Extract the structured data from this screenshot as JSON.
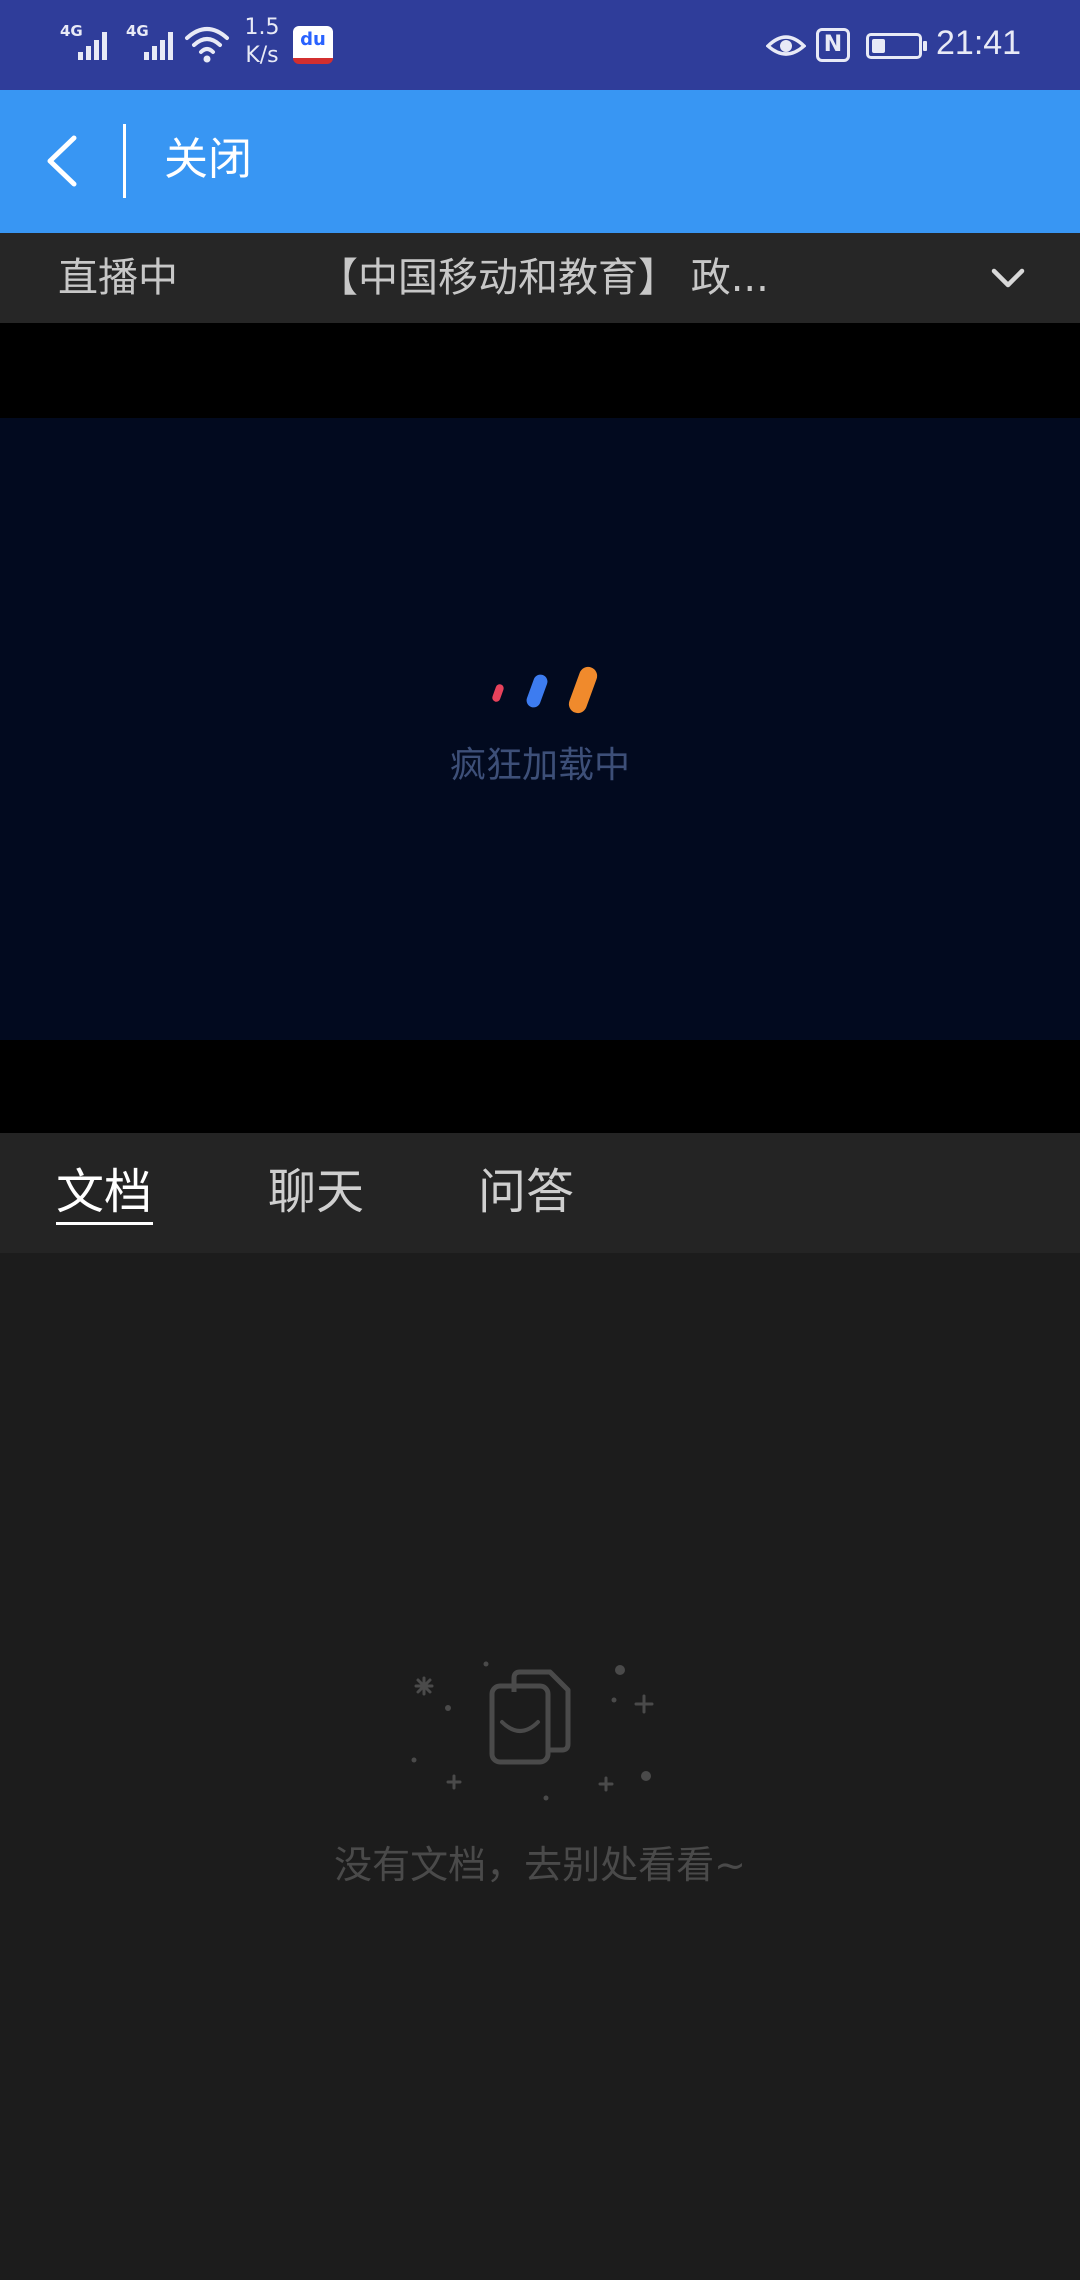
{
  "status_bar": {
    "network_1": "4G",
    "network_2": "4G",
    "speed_value": "1.5",
    "speed_unit": "K/s",
    "time": "21:41",
    "battery_level": 0.3,
    "icons": [
      "signal-icon",
      "wifi-icon",
      "baidu-app-icon",
      "eye-icon",
      "nfc-icon",
      "battery-icon"
    ]
  },
  "nav": {
    "close_label": "关闭"
  },
  "live_bar": {
    "status": "直播中",
    "title": "【中国移动和教育】 政..."
  },
  "player": {
    "loading_text": "疯狂加载中",
    "loader_colors": [
      "#e8425b",
      "#3d7cf0",
      "#f08a2c"
    ]
  },
  "tabs": [
    {
      "label": "文档",
      "active": true
    },
    {
      "label": "聊天",
      "active": false
    },
    {
      "label": "问答",
      "active": false
    }
  ],
  "empty_state": {
    "message": "没有文档，去别处看看~"
  },
  "colors": {
    "status_bar": "#2f3d9a",
    "nav_bar": "#3896f3",
    "live_bar": "#262626",
    "video_bg": "#020a1f",
    "page_bg": "#1c1c1c"
  }
}
